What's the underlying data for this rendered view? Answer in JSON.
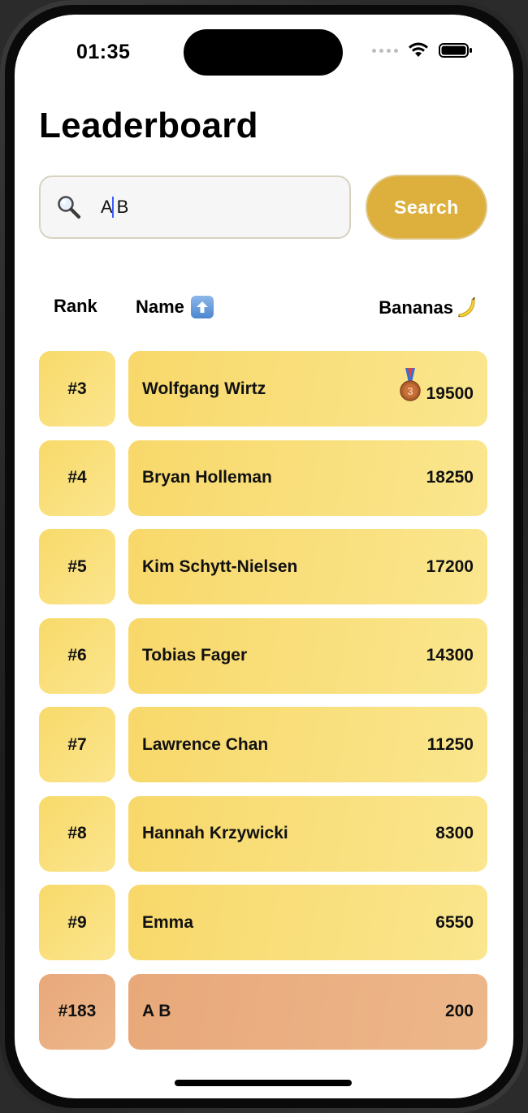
{
  "status_bar": {
    "time": "01:35"
  },
  "page": {
    "title": "Leaderboard"
  },
  "search": {
    "value": "A B",
    "button_label": "Search"
  },
  "table": {
    "headers": {
      "rank": "Rank",
      "name": "Name",
      "bananas": "Bananas"
    },
    "rows": [
      {
        "rank": "#3",
        "name": "Wolfgang Wirtz",
        "bananas": "19500",
        "medal": "bronze-medal-icon"
      },
      {
        "rank": "#4",
        "name": "Bryan Holleman",
        "bananas": "18250"
      },
      {
        "rank": "#5",
        "name": "Kim Schytt-Nielsen",
        "bananas": "17200"
      },
      {
        "rank": "#6",
        "name": "Tobias Fager",
        "bananas": "14300"
      },
      {
        "rank": "#7",
        "name": "Lawrence Chan",
        "bananas": "11250"
      },
      {
        "rank": "#8",
        "name": "Hannah Krzywicki",
        "bananas": "8300"
      },
      {
        "rank": "#9",
        "name": "Emma",
        "bananas": "6550"
      },
      {
        "rank": "#183",
        "name": "A B",
        "bananas": "200",
        "is_current_user": true
      }
    ]
  },
  "colors": {
    "accent": "#ddb03d",
    "row": "#f8d86a",
    "current_user_row": "#e8a87a"
  }
}
